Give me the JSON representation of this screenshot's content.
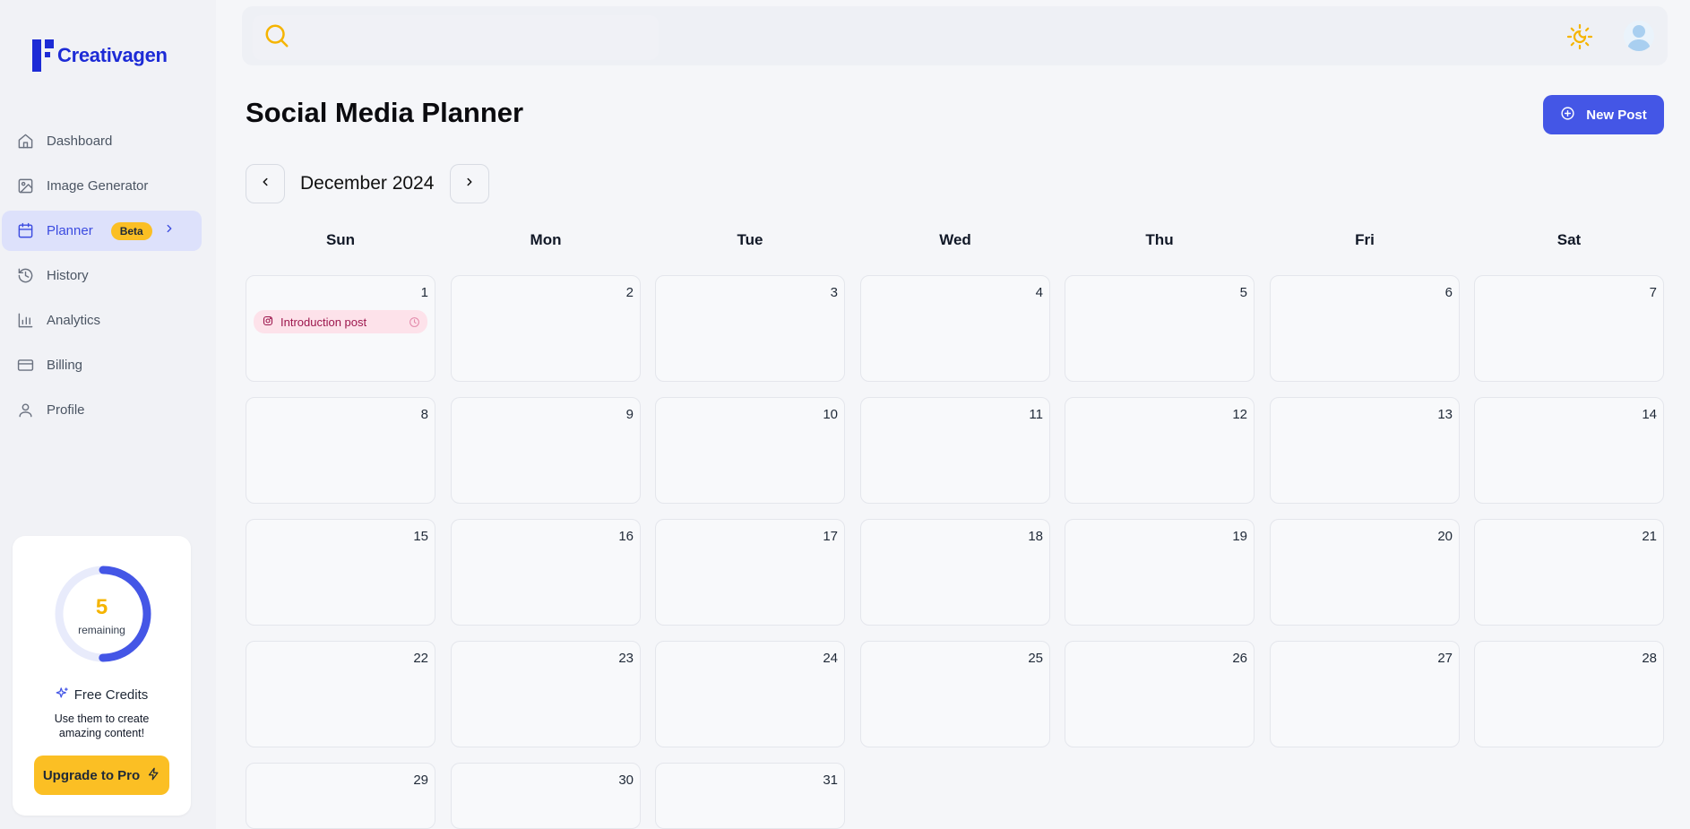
{
  "app": {
    "brand": "Creativagen"
  },
  "sidebar": {
    "items": [
      {
        "label": "Dashboard",
        "icon": "home-icon",
        "active": false
      },
      {
        "label": "Image Generator",
        "icon": "image-icon",
        "active": false
      },
      {
        "label": "Planner",
        "icon": "calendar-icon",
        "active": true,
        "badge": "Beta"
      },
      {
        "label": "History",
        "icon": "history-icon",
        "active": false
      },
      {
        "label": "Analytics",
        "icon": "bar-chart-icon",
        "active": false
      },
      {
        "label": "Billing",
        "icon": "credit-card-icon",
        "active": false
      },
      {
        "label": "Profile",
        "icon": "user-icon",
        "active": false
      }
    ],
    "credits": {
      "remaining": "5",
      "remaining_label": "remaining",
      "used_fraction": 0.5,
      "title": "Free Credits",
      "description": "Use them to create amazing content!",
      "upgrade_label": "Upgrade to Pro"
    }
  },
  "header": {
    "search_placeholder": "",
    "theme_icon": "sun-moon-icon",
    "avatar_icon": "user-avatar-icon"
  },
  "main": {
    "title": "Social Media Planner",
    "new_post_label": "New Post",
    "month_label": "December 2024",
    "weekdays": [
      "Sun",
      "Mon",
      "Tue",
      "Wed",
      "Thu",
      "Fri",
      "Sat"
    ],
    "days": [
      "1",
      "2",
      "3",
      "4",
      "5",
      "6",
      "7",
      "8",
      "9",
      "10",
      "11",
      "12",
      "13",
      "14",
      "15",
      "16",
      "17",
      "18",
      "19",
      "20",
      "21",
      "22",
      "23",
      "24",
      "25",
      "26",
      "27",
      "28",
      "29",
      "30",
      "31"
    ],
    "events": [
      {
        "day": "1",
        "label": "Introduction post",
        "platform_icon": "instagram-icon",
        "status_icon": "clock-icon"
      }
    ]
  },
  "colors": {
    "brand": "#1d2bd6",
    "accent": "#4456e6",
    "highlight": "#fbbf24",
    "event_bg": "#fde2ea",
    "event_text": "#9d174d"
  }
}
